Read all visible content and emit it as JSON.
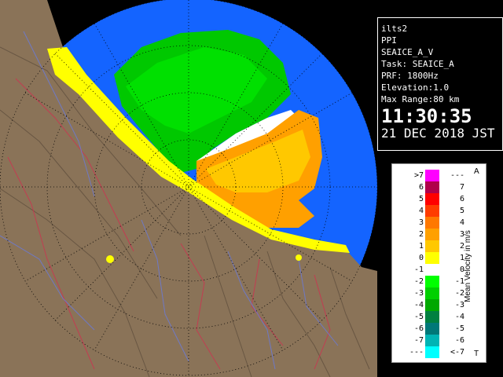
{
  "info": {
    "site": "ilts2",
    "product": "PPI",
    "task_v": "SEAICE_A_V",
    "task": "Task: SEAICE_A",
    "prf": "PRF: 1800Hz",
    "elevation": "Elevation:1.0",
    "max_range": "Max Range:80 km",
    "time": "11:30:35",
    "date": "21 DEC 2018 JST"
  },
  "legend": {
    "title": "Mean Velocity in m/s",
    "top_marker": "A",
    "bottom_marker": "T",
    "rows": [
      {
        "left": ">7",
        "right": "---",
        "color": "#ff00ff"
      },
      {
        "left": "6",
        "right": "7",
        "color": "#b0004a"
      },
      {
        "left": "5",
        "right": "6",
        "color": "#ff0000"
      },
      {
        "left": "4",
        "right": "5",
        "color": "#ff3c00"
      },
      {
        "left": "3",
        "right": "4",
        "color": "#ff7800"
      },
      {
        "left": "2",
        "right": "3",
        "color": "#ffa000"
      },
      {
        "left": "1",
        "right": "2",
        "color": "#ffc800"
      },
      {
        "left": "0",
        "right": "1",
        "color": "#ffff00"
      },
      {
        "left": "-1",
        "right": "0",
        "color": "#ffffff"
      },
      {
        "left": "-2",
        "right": "-1",
        "color": "#00ff00"
      },
      {
        "left": "-3",
        "right": "-2",
        "color": "#00d000"
      },
      {
        "left": "-4",
        "right": "-3",
        "color": "#00a800"
      },
      {
        "left": "-5",
        "right": "-4",
        "color": "#008040"
      },
      {
        "left": "-6",
        "right": "-5",
        "color": "#007878"
      },
      {
        "left": "-7",
        "right": "-6",
        "color": "#00b4b4"
      },
      {
        "left": "---",
        "right": "<-7",
        "color": "#00ffff"
      }
    ]
  },
  "colors": {
    "sea_background": "#1464ff",
    "land": "#8a7358",
    "coast_echo": "#ffff00"
  }
}
